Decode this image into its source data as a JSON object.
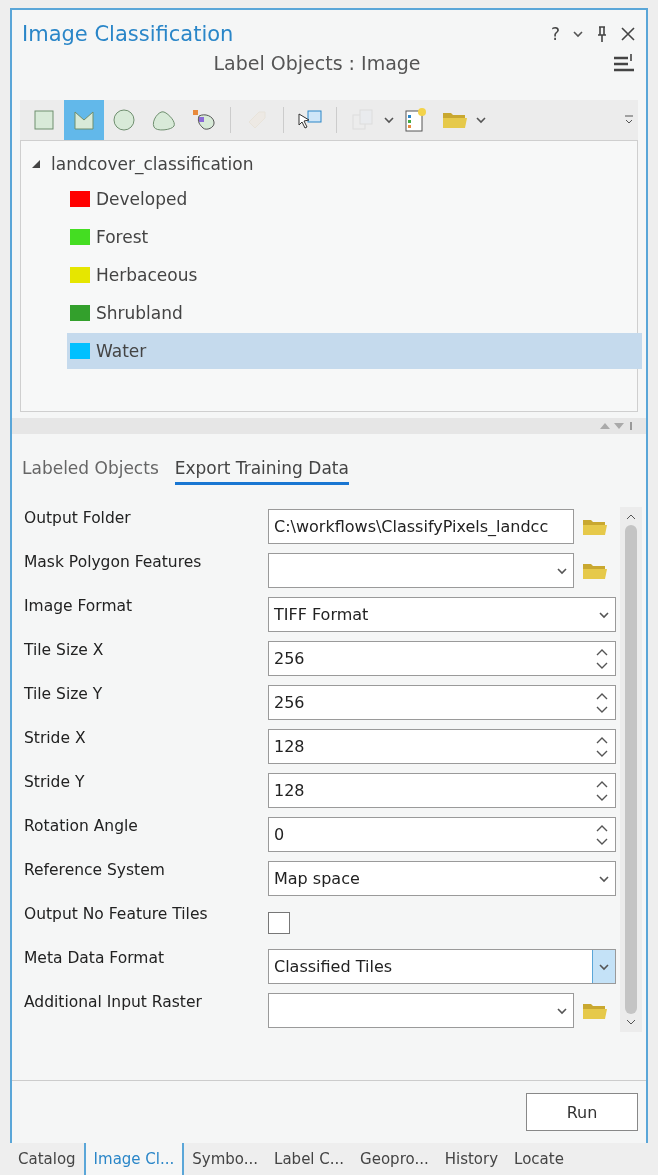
{
  "pane": {
    "title": "Image Classification",
    "help": "?",
    "subtitle": "Label Objects : Image"
  },
  "tools": [
    {
      "kind": "rect",
      "selected": false,
      "disabled": false
    },
    {
      "kind": "freehand",
      "selected": true,
      "disabled": false
    },
    {
      "kind": "circle",
      "selected": false,
      "disabled": false
    },
    {
      "kind": "lasso",
      "selected": false,
      "disabled": false
    },
    {
      "kind": "segment",
      "selected": false,
      "disabled": false
    },
    {
      "kind": "sep"
    },
    {
      "kind": "tag",
      "selected": false,
      "disabled": true
    },
    {
      "kind": "sep"
    },
    {
      "kind": "select",
      "selected": false,
      "disabled": false
    },
    {
      "kind": "sep"
    },
    {
      "kind": "multi",
      "selected": false,
      "disabled": true
    },
    {
      "kind": "schema",
      "selected": false,
      "disabled": false
    },
    {
      "kind": "folder",
      "selected": false,
      "disabled": false
    }
  ],
  "tree": {
    "label": "landcover_classification",
    "expanded": true,
    "children": [
      {
        "label": "Developed",
        "color": "#ff0000",
        "selected": false
      },
      {
        "label": "Forest",
        "color": "#44dd22",
        "selected": false
      },
      {
        "label": "Herbaceous",
        "color": "#e6e600",
        "selected": false
      },
      {
        "label": "Shrubland",
        "color": "#33a02c",
        "selected": false
      },
      {
        "label": "Water",
        "color": "#00c0ff",
        "selected": true
      }
    ]
  },
  "tabs": [
    {
      "label": "Labeled Objects",
      "selected": false
    },
    {
      "label": "Export Training Data",
      "selected": true
    }
  ],
  "params": [
    {
      "label": "Output Folder",
      "kind": "path",
      "value": "C:\\workflows\\ClassifyPixels_landcc"
    },
    {
      "label": "Mask Polygon Features",
      "kind": "dropbrowse"
    },
    {
      "label": "Image Format",
      "kind": "dropdown",
      "value": "TIFF Format",
      "focused": false
    },
    {
      "label": "Tile Size X",
      "kind": "spinner",
      "value": "256"
    },
    {
      "label": "Tile Size Y",
      "kind": "spinner",
      "value": "256"
    },
    {
      "label": "Stride X",
      "kind": "spinner",
      "value": "128"
    },
    {
      "label": "Stride Y",
      "kind": "spinner",
      "value": "128"
    },
    {
      "label": "Rotation Angle",
      "kind": "spinner",
      "value": "0"
    },
    {
      "label": "Reference System",
      "kind": "dropdown",
      "value": "Map space",
      "focused": false
    },
    {
      "label": "Output No Feature Tiles",
      "kind": "checkbox",
      "checked": false
    },
    {
      "label": "Meta Data Format",
      "kind": "dropdown",
      "value": "Classified Tiles",
      "focused": true
    },
    {
      "label": "Additional Input Raster",
      "kind": "dropbrowse"
    }
  ],
  "run_button": "Run",
  "dock_tabs": [
    {
      "label": "Catalog",
      "selected": false
    },
    {
      "label": "Image Cl...",
      "selected": true
    },
    {
      "label": "Symbo...",
      "selected": false
    },
    {
      "label": "Label C...",
      "selected": false
    },
    {
      "label": "Geopro...",
      "selected": false
    },
    {
      "label": "History",
      "selected": false
    },
    {
      "label": "Locate",
      "selected": false
    }
  ]
}
